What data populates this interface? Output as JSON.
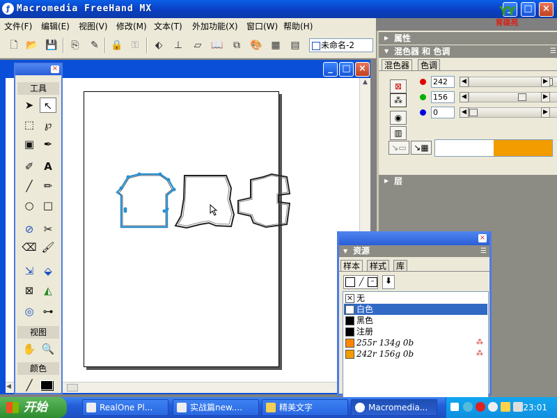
{
  "app": {
    "title": "Macromedia FreeHand MX",
    "icon": "freehand-icon"
  },
  "window_controls": {
    "minimize": "_",
    "maximize": "□",
    "close": "×"
  },
  "logo": {
    "glyph": "YY",
    "text": "育碟苑"
  },
  "menu": [
    "文件(F)",
    "编辑(E)",
    "视图(V)",
    "修改(M)",
    "文本(T)",
    "外加功能(X)",
    "窗口(W)",
    "帮助(H)"
  ],
  "toolbar": {
    "icons": [
      "new-icon",
      "open-icon",
      "save-icon",
      "import-icon",
      "export-icon",
      "lock-icon",
      "unlock-icon",
      "group-icon",
      "ungroup-icon",
      "align-icon",
      "find-icon",
      "transform-icon",
      "color-mixer-icon",
      "table-icon",
      "layers-icon"
    ],
    "document_selector": "未命名-2"
  },
  "right_panel": {
    "properties_title": "属性",
    "mixer_title": "混色器 和 色调",
    "tabs": [
      "混色器",
      "色调"
    ],
    "active_tab": "混色器",
    "channels": [
      {
        "name": "red",
        "color": "#e00000",
        "value": "242"
      },
      {
        "name": "green",
        "color": "#00b000",
        "value": "156"
      },
      {
        "name": "blue",
        "color": "#0000e0",
        "value": "0"
      }
    ],
    "channel_levels": [
      0.949,
      0.612,
      0.0
    ],
    "preview_colors": [
      "#ffffff",
      "#f29c00"
    ],
    "layers_title": "层"
  },
  "tools_panel": {
    "title": "工具",
    "view_title": "视图",
    "color_title": "颜色",
    "tools": [
      "pointer-tool",
      "subselect-tool",
      "lasso-tool",
      "freeform-tool",
      "page-tool",
      "eyedropper-tool",
      "pen-tool",
      "text-tool",
      "line-tool",
      "pencil-tool",
      "ellipse-tool",
      "rectangle-tool",
      "polygon-tool",
      "knife-tool",
      "eraser-tool",
      "brush-tool",
      "scale-tool",
      "paint-bucket-tool",
      "trace-tool",
      "gradient-tool",
      "chart-tool",
      "connector-tool"
    ],
    "view_tools": [
      "hand-tool",
      "zoom-tool"
    ]
  },
  "assets": {
    "title": "资源",
    "tabs": [
      "样本",
      "样式",
      "库"
    ],
    "active_tab": "样本",
    "swatches": [
      {
        "label": "无",
        "color": "none"
      },
      {
        "label": "白色",
        "color": "#ffffff",
        "selected": true
      },
      {
        "label": "黑色",
        "color": "#000000"
      },
      {
        "label": "注册",
        "color": "#000000"
      },
      {
        "label": "255r 134g 0b",
        "color": "#ff8600",
        "italic": true
      },
      {
        "label": "242r 156g 0b",
        "color": "#f29c00",
        "italic": true
      }
    ]
  },
  "taskbar": {
    "start": "开始",
    "tasks": [
      "RealOne Pl...",
      "实战篇new....",
      "精美文字",
      "Macromedia..."
    ],
    "active_task": "Macromedia...",
    "clock": "23:01"
  }
}
